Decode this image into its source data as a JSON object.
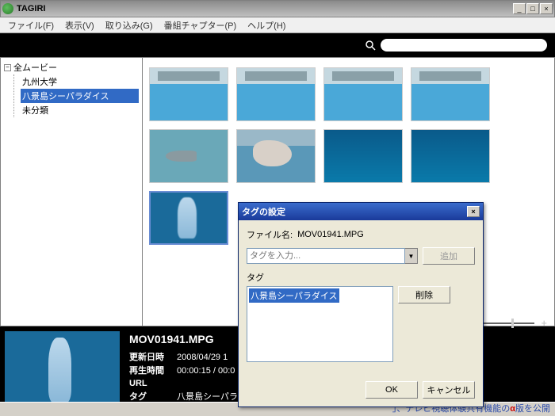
{
  "window": {
    "title": "TAGIRI"
  },
  "menu": {
    "file": "ファイル(F)",
    "view": "表示(V)",
    "import": "取り込み(G)",
    "chapter": "番組チャプター(P)",
    "help": "ヘルプ(H)"
  },
  "search": {
    "placeholder": ""
  },
  "tree": {
    "root": "全ムービー",
    "items": [
      "九州大学",
      "八景島シーパラダイス",
      "未分類"
    ]
  },
  "selected": {
    "filename": "MOV01941.MPG",
    "labels": {
      "updated": "更新日時",
      "duration": "再生時間",
      "url": "URL",
      "tag": "タグ"
    },
    "updated": "2008/04/29 1",
    "duration": "00:00:15 / 00:0",
    "url": "",
    "tag": "八景島シーパラダイス"
  },
  "dialog": {
    "title": "タグの設定",
    "file_label": "ファイル名:",
    "filename": "MOV01941.MPG",
    "input_placeholder": "タグを入力...",
    "add": "追加",
    "tag_label": "タグ",
    "delete": "削除",
    "tags": [
      "八景島シーパラダイス"
    ],
    "ok": "OK",
    "cancel": "キャンセル"
  },
  "footer": {
    "prefix": "」、テレビ視聴体験共有機能の",
    "alpha": "α",
    "suffix": "版を公開"
  }
}
